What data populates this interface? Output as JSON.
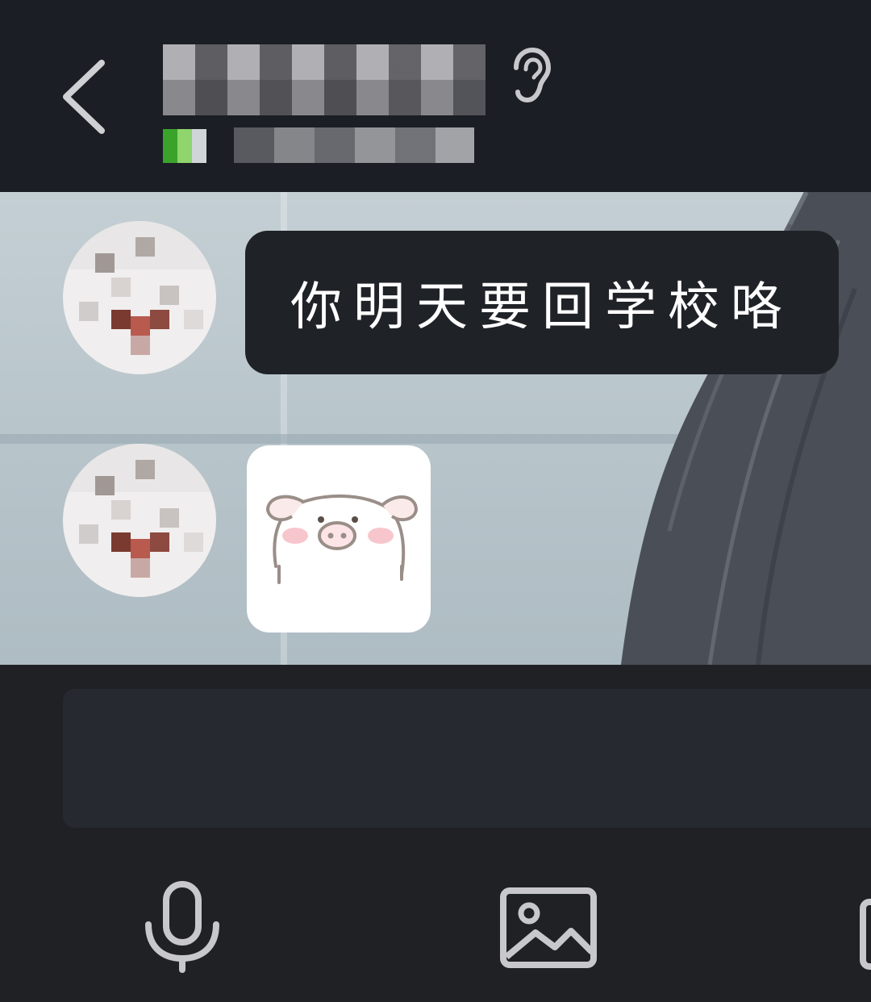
{
  "header": {
    "back_icon": "chevron-left-icon",
    "contact_name": "",
    "contact_status": "",
    "earpiece_icon": "ear-icon"
  },
  "messages": [
    {
      "type": "text",
      "sender": "contact",
      "text": "你明天要回学校咯"
    },
    {
      "type": "sticker",
      "sender": "contact",
      "sticker": "pink-pig-sticker"
    }
  ],
  "input": {
    "value": "",
    "placeholder": ""
  },
  "toolbar": {
    "icons": [
      "microphone-icon",
      "image-icon",
      "more-icon"
    ]
  },
  "colors": {
    "header_bg": "#1b1e24",
    "bubble_bg": "#1f2227",
    "bubble_text": "#ffffff",
    "input_bg": "#262930",
    "icon_color": "#c8c8cc"
  }
}
